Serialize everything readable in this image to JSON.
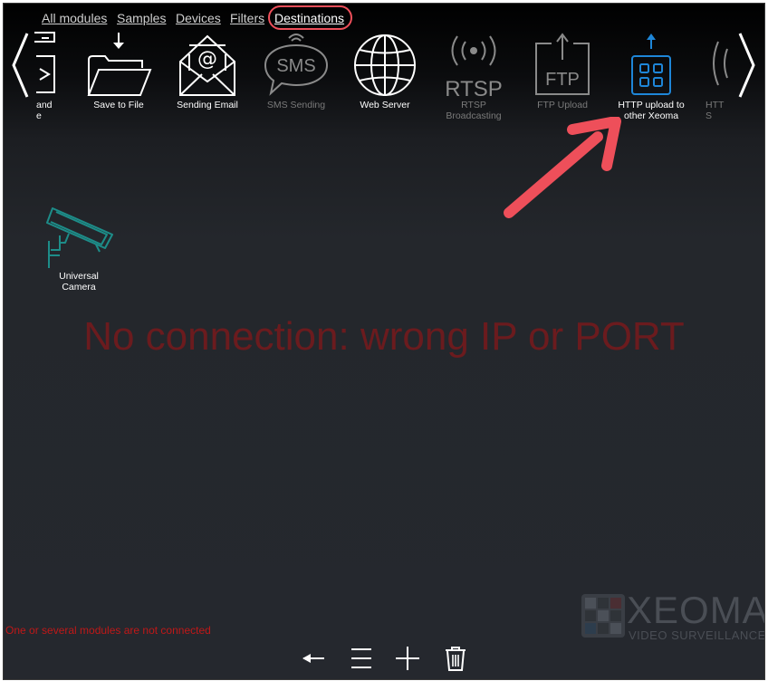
{
  "tabs": [
    {
      "label": "All modules"
    },
    {
      "label": "Samples"
    },
    {
      "label": "Devices"
    },
    {
      "label": "Filters"
    },
    {
      "label": "Destinations"
    }
  ],
  "modules": [
    {
      "label": "and\ne",
      "icon": "archive-icon",
      "dim": false
    },
    {
      "label": "Save to File",
      "icon": "folder-download-icon",
      "dim": false
    },
    {
      "label": "Sending Email",
      "icon": "email-icon",
      "dim": false
    },
    {
      "label": "SMS Sending",
      "icon": "sms-icon",
      "dim": true
    },
    {
      "label": "Web Server",
      "icon": "globe-icon",
      "dim": false
    },
    {
      "label": "RTSP\nBroadcasting",
      "icon": "rtsp-icon",
      "icon_text": "RTSP",
      "dim": true
    },
    {
      "label": "FTP Upload",
      "icon": "ftp-upload-icon",
      "icon_text": "FTP",
      "dim": true
    },
    {
      "label": "HTTP upload to\nother Xeoma",
      "icon": "http-upload-icon",
      "dim": false
    },
    {
      "label": "HTT\nS",
      "icon": "broadcast-icon",
      "dim": true
    }
  ],
  "sms_icon_text": "SMS",
  "camera": {
    "label": "Universal\nCamera",
    "icon": "camera-icon"
  },
  "message": "No connection: wrong IP or PORT",
  "status": "One or several modules are not connected",
  "logo": {
    "title": "XEOMA",
    "subtitle": "VIDEO SURVEILLANCE"
  },
  "toolbar": [
    {
      "icon": "back-arrow-icon"
    },
    {
      "icon": "menu-icon"
    },
    {
      "icon": "add-icon"
    },
    {
      "icon": "trash-icon"
    }
  ],
  "colors": {
    "highlight": "#ee4f5a",
    "accent_blue": "#1e86d8",
    "camera_teal": "#1d8d89",
    "error_text": "#c01818"
  }
}
